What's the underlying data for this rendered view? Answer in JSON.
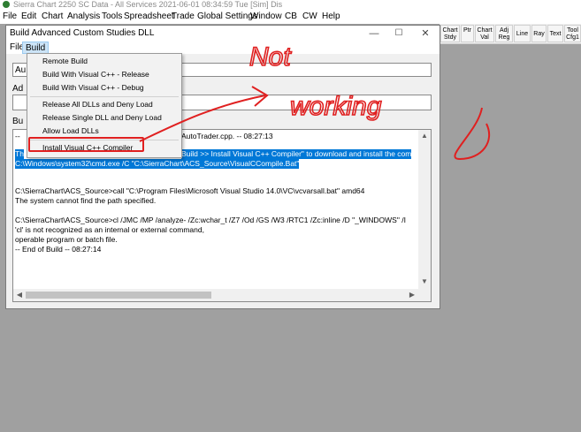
{
  "app_title": "Sierra Chart 2250 SC Data - All Services 2021-06-01 08:34:59 Tue [Sim]  Dis",
  "main_menu": [
    "File",
    "Edit",
    "Chart",
    "Analysis",
    "Tools",
    "Spreadsheet",
    "Trade",
    "Global Settings",
    "Window",
    "CB",
    "CW",
    "Help"
  ],
  "toolbar": [
    "Chart Stdy",
    "Ptr",
    "Chart Val",
    "Adj Reg",
    "Line",
    "Ray",
    "Text",
    "Tool Cfg1"
  ],
  "dialog": {
    "title": "Build Advanced Custom Studies DLL",
    "controls": {
      "minimize": "—",
      "maximize": "☐",
      "close": "✕"
    },
    "menu": [
      "File",
      "Build"
    ],
    "field1_label": "",
    "field1_value": "Au",
    "field2_label": "Ad",
    "field3_label": "Bu",
    "output_lines": [
      "-- ",
      "AutoTrader.cpp.  --      08:27:13",
      "Th",
      "Build >> Install Visual C++ Compiler\" to download and install the com",
      "C:\\Windows\\system32\\cmd.exe /C \"C:\\SierraChart\\ACS_Source\\VisualCCompile.Bat\"",
      "C:\\SierraChart\\ACS_Source>call \"C:\\Program Files\\Microsoft Visual Studio 14.0\\VC\\vcvarsall.bat\" amd64",
      "The system cannot find the path specified.",
      "C:\\SierraChart\\ACS_Source>cl /JMC /MP /analyze- /Zc:wchar_t /Z7 /Od /GS /W3 /RTC1 /Zc:inline /D \"_WINDOWS\" /I",
      "'cl' is not recognized as an internal or external command,",
      "operable program or batch file.",
      "-- End of Build --     08:27:14"
    ]
  },
  "build_menu": {
    "items": [
      "Remote Build",
      "Build With Visual C++ - Release",
      "Build With Visual C++ - Debug",
      "Release All DLLs and Deny Load",
      "Release Single DLL and Deny Load",
      "Allow Load DLLs",
      "Install Visual C++ Compiler"
    ]
  },
  "annotation": {
    "line1": "Not",
    "line2": "working",
    "color": "#e02020"
  },
  "icons": {
    "app": "sierra-logo-icon",
    "scroll_up": "▲",
    "scroll_down": "▼",
    "scroll_left": "◀",
    "scroll_right": "▶"
  }
}
